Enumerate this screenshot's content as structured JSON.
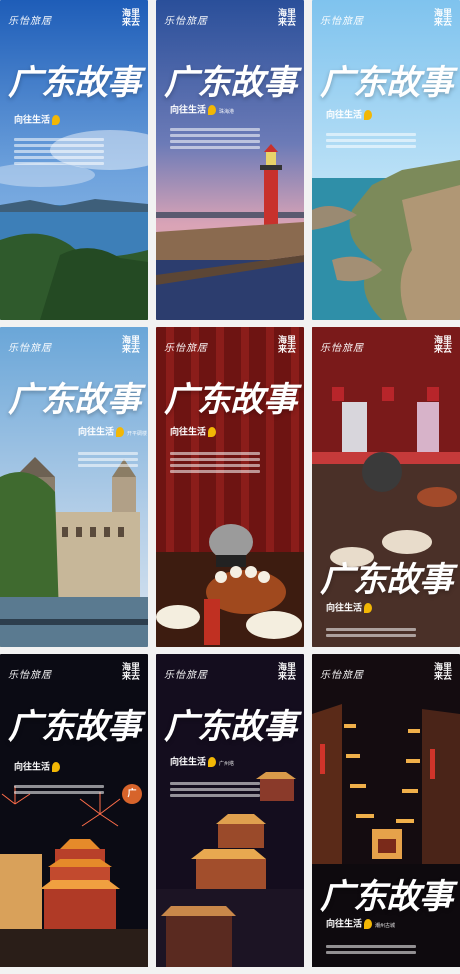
{
  "posters": [
    {
      "brand": "乐怡旅居",
      "seal": "海里来去",
      "title": "广东故事",
      "tagline": "向往生活",
      "subline": ""
    },
    {
      "brand": "乐怡旅居",
      "seal": "海里来去",
      "title": "广东故事",
      "tagline": "向往生活",
      "subline": "珠海港"
    },
    {
      "brand": "乐怡旅居",
      "seal": "海里来去",
      "title": "广东故事",
      "tagline": "向往生活",
      "subline": ""
    },
    {
      "brand": "乐怡旅居",
      "seal": "海里来去",
      "title": "广东故事",
      "tagline": "向往生活",
      "subline": "开平碉楼"
    },
    {
      "brand": "乐怡旅居",
      "seal": "海里来去",
      "title": "广东故事",
      "tagline": "向往生活",
      "subline": ""
    },
    {
      "brand": "乐怡旅居",
      "seal": "海里来去",
      "title": "广东故事",
      "tagline": "向往生活",
      "subline": ""
    },
    {
      "brand": "乐怡旅居",
      "seal": "海里来去",
      "title": "广东故事",
      "tagline": "向往生活",
      "subline": ""
    },
    {
      "brand": "乐怡旅居",
      "seal": "海里来去",
      "title": "广东故事",
      "tagline": "向往生活",
      "subline": "广州塔"
    },
    {
      "brand": "乐怡旅居",
      "seal": "海里来去",
      "title": "广东故事",
      "tagline": "向往生活",
      "subline": "潮州古城"
    }
  ],
  "badge_text": "广",
  "colors": {
    "accent": "#f2b705",
    "white": "#ffffff"
  }
}
